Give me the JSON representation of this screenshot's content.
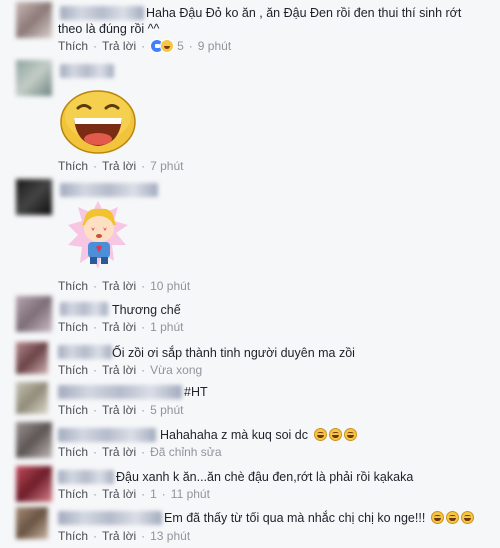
{
  "actions": {
    "like_label": "Thích",
    "reply_label": "Trả lời",
    "dot": "·"
  },
  "comments": [
    {
      "text": "Haha Đậu Đỏ ko ăn , ăn Đậu Đen rồi đen thui thí sinh rớt theo là đúng rồi ^^",
      "reaction_count": "5",
      "time": "9 phút"
    },
    {
      "text": "",
      "sticker": "laughing-face-sticker",
      "time": "7 phút"
    },
    {
      "text": "",
      "sticker": "cartoon-boy-sticker",
      "time": "10 phút"
    },
    {
      "text": "Thương chế",
      "time": "1 phút"
    },
    {
      "text": "Ối zồi ơi sắp thành tinh người duyên ma zồi",
      "time": "Vừa xong"
    },
    {
      "text": "#HT",
      "time": "5 phút"
    },
    {
      "text": "Hahahaha z mà kuq soi dc",
      "emoji_count": 3,
      "time": "Đã chỉnh sửa"
    },
    {
      "text": "Đậu xanh k ăn...ăn chè đậu đen,rớt là phải rồi kạkaka",
      "reply_count": "1",
      "time": "11 phút"
    },
    {
      "text": "Em đã thấy từ tối qua mà nhắc chị chị ko nge!!!",
      "emoji_count": 3,
      "time": "13 phút"
    }
  ]
}
